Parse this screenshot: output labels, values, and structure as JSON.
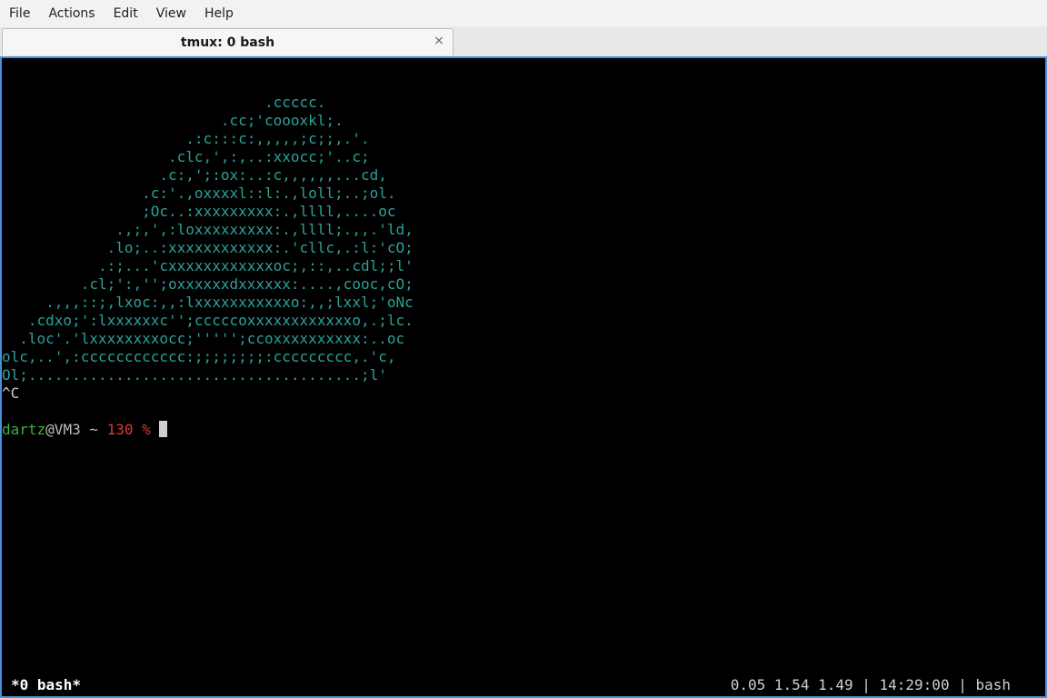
{
  "menubar": {
    "items": [
      "File",
      "Actions",
      "Edit",
      "View",
      "Help"
    ]
  },
  "tab": {
    "title": "tmux: 0 bash",
    "close_glyph": "×"
  },
  "terminal": {
    "art_lines": [
      "                              .ccccc.",
      "                         .cc;'coooxkl;.",
      "                     .:c:::c:,,,,,;c;;,.'.",
      "                   .clc,',:,..:xxocc;'..c;",
      "                  .c:,';:ox:..:c,,,,,,...cd,",
      "                .c:'.,oxxxxl::l:.,loll;..;ol.",
      "                ;Oc..:xxxxxxxxx:.,llll,....oc",
      "             .,;,',:loxxxxxxxxx:.,llll;.,,.'ld,",
      "            .lo;..:xxxxxxxxxxxx:.'cllc,.:l:'cO;",
      "           .:;...'cxxxxxxxxxxxxoc;,::,..cdl;;l'",
      "         .cl;':,'';oxxxxxxdxxxxxx:....,cooc,cO;",
      "     .,,,::;,lxoc:,,:lxxxxxxxxxxxo:,,;lxxl;'oNc",
      "   .cdxo;':lxxxxxxc'';cccccoxxxxxxxxxxxxo,.;lc.",
      "  .loc'.'lxxxxxxxxocc;''''';ccoxxxxxxxxxx:..oc",
      "olc,..',:cccccccccccc:;;;;;;;;:ccccccccc,.'c,",
      "Ol;......................................;l'"
    ],
    "interrupt": "^C",
    "prompt": {
      "user": "dartz",
      "host": "@VM3 ~ ",
      "exit_code": "130 %",
      "input": ""
    }
  },
  "status": {
    "left": "*0 bash*",
    "right": "0.05 1.54 1.49 | 14:29:00 | bash"
  },
  "colors": {
    "art": "#2aa198",
    "prompt_user": "#3fae3f",
    "prompt_code": "#d73a3a",
    "focus_border": "#4a90d9"
  }
}
